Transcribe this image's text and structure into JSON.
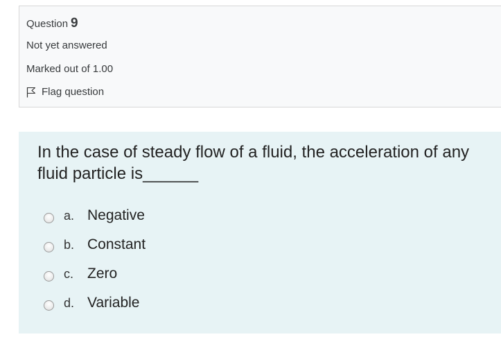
{
  "question_info": {
    "question_word": "Question",
    "question_number": "9",
    "state": "Not yet answered",
    "grade": "Marked out of 1.00",
    "flag_label": "Flag question"
  },
  "question": {
    "text": "In the case of steady flow of a fluid, the acceleration of any fluid particle is______",
    "answers": [
      {
        "letter": "a.",
        "text": "Negative",
        "selected": false
      },
      {
        "letter": "b.",
        "text": "Constant",
        "selected": false
      },
      {
        "letter": "c.",
        "text": "Zero",
        "selected": false
      },
      {
        "letter": "d.",
        "text": "Variable",
        "selected": false
      }
    ]
  },
  "colors": {
    "info_background": "#f8f9fa",
    "content_background": "#e7f3f5"
  },
  "icons": {
    "flag": "flag-icon",
    "radio": "radio-icon"
  }
}
